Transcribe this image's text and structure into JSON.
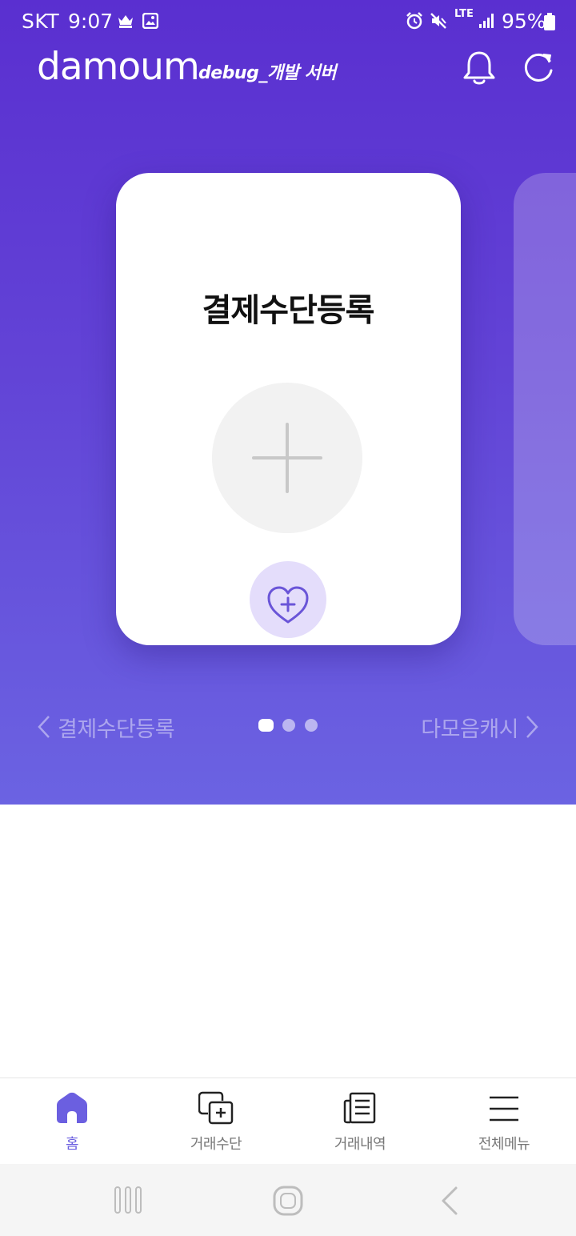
{
  "status_bar": {
    "carrier": "SKT",
    "time": "9:07",
    "network": "LTE",
    "battery": "95%",
    "icons": [
      "crown-icon",
      "gallery-icon",
      "alarm-icon",
      "mute-icon",
      "signal-icon",
      "battery-icon"
    ]
  },
  "header": {
    "logo": "damoum",
    "environment": "debug_개발 서버",
    "icons": [
      "bell-icon",
      "refresh-icon"
    ]
  },
  "card": {
    "title": "결제수단등록",
    "icons": [
      "plus-icon",
      "heart-plus-icon"
    ]
  },
  "pager": {
    "prev_label": "결제수단등록",
    "next_label": "다모음캐시",
    "page_count": 3,
    "current_page": 1
  },
  "tabbar": {
    "tabs": [
      {
        "label": "홈",
        "icon": "home-icon",
        "active": true
      },
      {
        "label": "거래수단",
        "icon": "payment-method-icon",
        "active": false
      },
      {
        "label": "거래내역",
        "icon": "history-icon",
        "active": false
      },
      {
        "label": "전체메뉴",
        "icon": "menu-icon",
        "active": false
      }
    ]
  },
  "colors": {
    "hero_top": "#5a2fd0",
    "hero_bottom": "#6b63e2",
    "accent": "#6b5fe0",
    "heart_bg": "#e4ddfb"
  }
}
